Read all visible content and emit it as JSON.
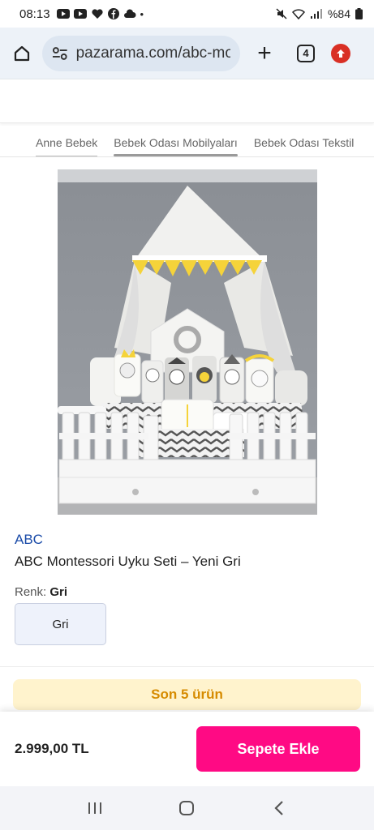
{
  "status": {
    "time": "08:13",
    "battery": "%84",
    "icons": [
      "youtube-icon",
      "youtube-icon",
      "heart-icon",
      "facebook-icon",
      "cloud-icon",
      "dot-icon"
    ]
  },
  "browser": {
    "url": "pazarama.com/abc-mo",
    "tab_count": "4"
  },
  "breadcrumb": [
    "Anne Bebek",
    "Bebek Odası Mobilyaları",
    "Bebek Odası Tekstil"
  ],
  "product": {
    "brand": "ABC",
    "title": "ABC Montessori Uyku Seti – Yeni Gri",
    "color_label": "Renk:",
    "color_value": "Gri",
    "swatch": "Gri"
  },
  "stock_notice": "Son 5 ürün",
  "cart": {
    "price": "2.999,00 TL",
    "button": "Sepete Ekle"
  },
  "colors": {
    "accent": "#ff0a84",
    "brand_link": "#1a4ba8",
    "stock_bg": "#fff3cd",
    "stock_text": "#d68b00"
  }
}
